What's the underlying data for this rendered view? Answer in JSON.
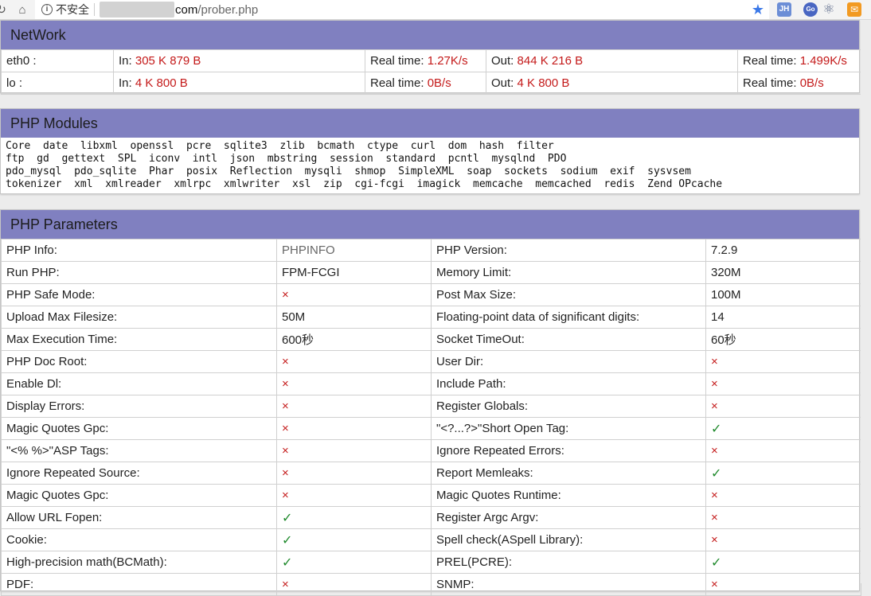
{
  "browser": {
    "security_label": "不安全",
    "url_host": "com",
    "url_path": "/prober.php",
    "extensions": [
      "JH",
      "Go",
      "⚛",
      "✉"
    ]
  },
  "network": {
    "title": "NetWork",
    "rows": [
      {
        "iface": "eth0 :",
        "in_label": "In: ",
        "in_value": "305 K 879 B",
        "rt1_label": "Real time: ",
        "rt1_value": "1.27K/s",
        "out_label": "Out: ",
        "out_value": "844 K 216 B",
        "rt2_label": "Real time: ",
        "rt2_value": "1.499K/s"
      },
      {
        "iface": "lo :",
        "in_label": "In: ",
        "in_value": "4 K 800 B",
        "rt1_label": "Real time: ",
        "rt1_value": "0B/s",
        "out_label": "Out: ",
        "out_value": "4 K 800 B",
        "rt2_label": "Real time: ",
        "rt2_value": "0B/s"
      }
    ]
  },
  "modules": {
    "title": "PHP Modules",
    "lines": [
      "Core  date  libxml  openssl  pcre  sqlite3  zlib  bcmath  ctype  curl  dom  hash  filter",
      "ftp  gd  gettext  SPL  iconv  intl  json  mbstring  session  standard  pcntl  mysqlnd  PDO",
      "pdo_mysql  pdo_sqlite  Phar  posix  Reflection  mysqli  shmop  SimpleXML  soap  sockets  sodium  exif  sysvsem",
      "tokenizer  xml  xmlreader  xmlrpc  xmlwriter  xsl  zip  cgi-fcgi  imagick  memcache  memcached  redis  Zend OPcache"
    ]
  },
  "params": {
    "title": "PHP Parameters",
    "rows": [
      {
        "l1": "PHP Info:",
        "v1": "PHPINFO",
        "t1": "gray",
        "l2": "PHP Version:",
        "v2": "7.2.9",
        "t2": "text"
      },
      {
        "l1": "Run PHP:",
        "v1": "FPM-FCGI",
        "t1": "text",
        "l2": "Memory Limit:",
        "v2": "320M",
        "t2": "text"
      },
      {
        "l1": "PHP Safe Mode:",
        "v1": "×",
        "t1": "red",
        "l2": "Post Max Size:",
        "v2": "100M",
        "t2": "text"
      },
      {
        "l1": "Upload Max Filesize:",
        "v1": "50M",
        "t1": "text",
        "l2": "Floating-point data of significant digits:",
        "v2": "14",
        "t2": "text"
      },
      {
        "l1": "Max Execution Time:",
        "v1": "600秒",
        "t1": "text",
        "l2": "Socket TimeOut:",
        "v2": "60秒",
        "t2": "text"
      },
      {
        "l1": "PHP Doc Root:",
        "v1": "×",
        "t1": "red",
        "l2": "User Dir:",
        "v2": "×",
        "t2": "red"
      },
      {
        "l1": "Enable Dl:",
        "v1": "×",
        "t1": "red",
        "l2": "Include Path:",
        "v2": "×",
        "t2": "red"
      },
      {
        "l1": "Display Errors:",
        "v1": "×",
        "t1": "red",
        "l2": "Register Globals:",
        "v2": "×",
        "t2": "red"
      },
      {
        "l1": "Magic Quotes Gpc:",
        "v1": "×",
        "t1": "red",
        "l2": "\"<?...?>\"Short Open Tag:",
        "v2": "✓",
        "t2": "green"
      },
      {
        "l1": "\"<% %>\"ASP Tags:",
        "v1": "×",
        "t1": "red",
        "l2": "Ignore Repeated Errors:",
        "v2": "×",
        "t2": "red"
      },
      {
        "l1": "Ignore Repeated Source:",
        "v1": "×",
        "t1": "red",
        "l2": "Report Memleaks:",
        "v2": "✓",
        "t2": "green"
      },
      {
        "l1": "Magic Quotes Gpc:",
        "v1": "×",
        "t1": "red",
        "l2": "Magic Quotes Runtime:",
        "v2": "×",
        "t2": "red"
      },
      {
        "l1": "Allow URL Fopen:",
        "v1": "✓",
        "t1": "green",
        "l2": "Register Argc Argv:",
        "v2": "×",
        "t2": "red"
      },
      {
        "l1": "Cookie:",
        "v1": "✓",
        "t1": "green",
        "l2": "Spell check(ASpell Library):",
        "v2": "×",
        "t2": "red"
      },
      {
        "l1": "High-precision math(BCMath):",
        "v1": "✓",
        "t1": "green",
        "l2": "PREL(PCRE):",
        "v2": "✓",
        "t2": "green"
      },
      {
        "l1": "PDF:",
        "v1": "×",
        "t1": "red",
        "l2": "SNMP:",
        "v2": "×",
        "t2": "red"
      }
    ]
  }
}
